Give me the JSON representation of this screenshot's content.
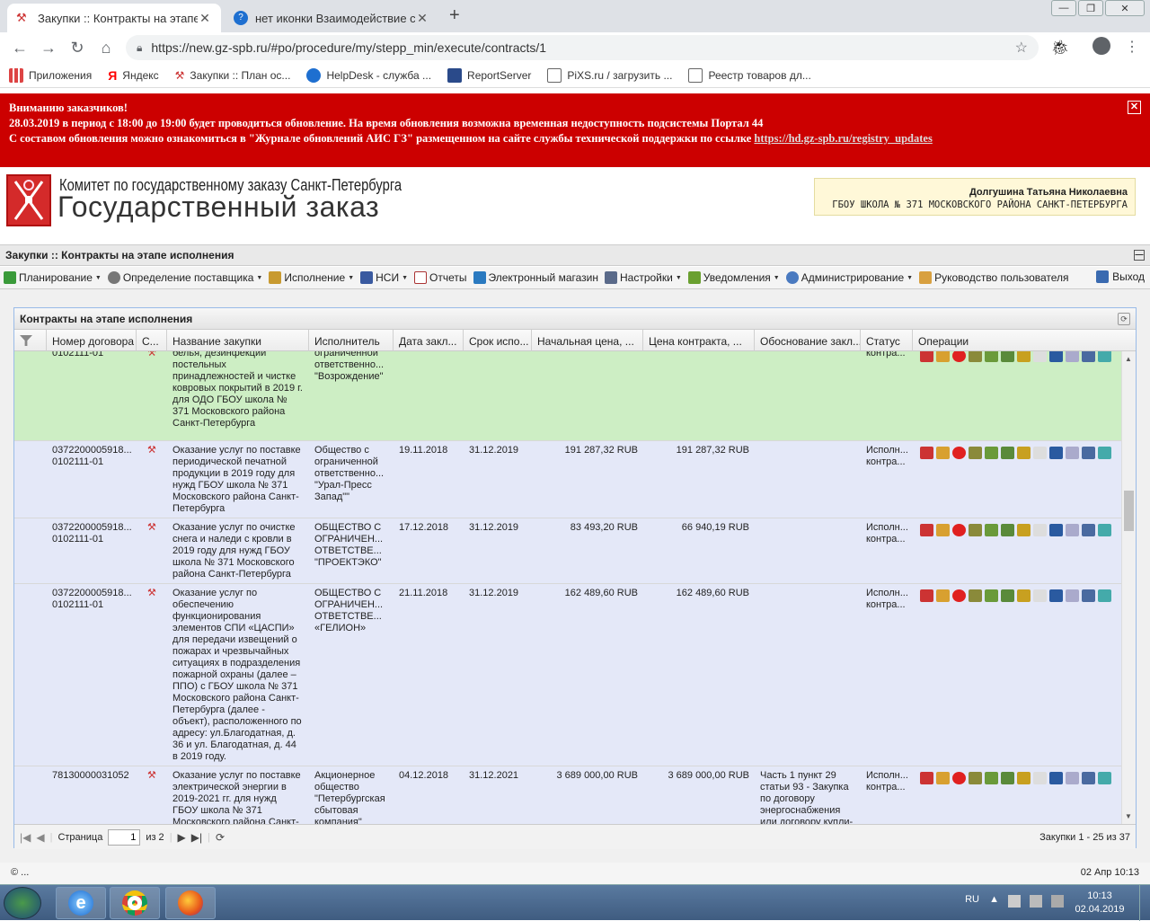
{
  "browser": {
    "tabs": [
      {
        "title": "Закупки :: Контракты на этапе и",
        "active": true
      },
      {
        "title": "нет иконки Взаимодействие с Е",
        "active": false
      }
    ],
    "new_tab": "+",
    "url": "https://new.gz-spb.ru/#po/procedure/my/stepp_min/execute/contracts/1",
    "bookmarks": [
      "Приложения",
      "Яндекс",
      "Закупки :: План ос...",
      "HelpDesk - служба ...",
      "ReportServer",
      "PiXS.ru / загрузить ...",
      "Реестр товаров дл..."
    ]
  },
  "alert": {
    "line1": "Вниманию заказчиков!",
    "line2": "28.03.2019 в период с 18:00 до 19:00 будет проводиться обновление. На время обновления возможна временная недоступность подсистемы Портал 44",
    "line3": "С составом обновления можно ознакомиться в \"Журнале обновлений АИС ГЗ\" размещенном на сайте службы технической поддержки по ссылке",
    "link": "https://hd.gz-spb.ru/registry_updates"
  },
  "header": {
    "org_line1": "Комитет по государственному заказу Санкт-Петербурга",
    "org_line2": "Государственный заказ",
    "user_name": "Долгушина Татьяна Николаевна",
    "user_org": "ГБОУ ШКОЛА № 371 МОСКОВСКОГО РАЙОНА САНКТ-ПЕТЕРБУРГА"
  },
  "panel_title": "Закупки :: Контракты на этапе исполнения",
  "menu": {
    "items": [
      "Планирование",
      "Определение поставщика",
      "Исполнение",
      "НСИ",
      "Отчеты",
      "Электронный магазин",
      "Настройки",
      "Уведомления",
      "Администрирование",
      "Руководство пользователя"
    ],
    "logout": "Выход"
  },
  "grid": {
    "title": "Контракты на этапе исполнения",
    "columns": [
      "Номер договора",
      "С...",
      "Название закупки",
      "Исполнитель",
      "Дата закл...",
      "Срок испо...",
      "Начальная цена, ...",
      "Цена контракта, ...",
      "Обоснование закл...",
      "Статус",
      "Операции"
    ],
    "rows": [
      {
        "number": "0102111-01",
        "name": "белья, дезинфекции постельных принадлежностей и чистке ковровых покрытий в 2019 г. для ОДО ГБОУ школа № 371 Московского района Санкт-Петербурга",
        "executor": "ограниченной ответственно... \"Возрождение\"",
        "date": "",
        "term": "",
        "start_price": "",
        "price": "",
        "basis": "",
        "status": "контра..."
      },
      {
        "number": "0372200005918... 0102111-01",
        "name": "Оказание услуг по поставке периодической печатной продукции в 2019 году для нужд ГБОУ школа № 371 Московского района Санкт-Петербурга",
        "executor": "Общество с ограниченной ответственно... \"Урал-Пресс Запад\"\"",
        "date": "19.11.2018",
        "term": "31.12.2019",
        "start_price": "191 287,32 RUB",
        "price": "191 287,32 RUB",
        "basis": "",
        "status": "Исполн... контра..."
      },
      {
        "number": "0372200005918... 0102111-01",
        "name": "Оказание услуг по очистке снега и наледи с кровли в 2019 году для нужд ГБОУ школа № 371 Московского района Санкт-Петербурга",
        "executor": "ОБЩЕСТВО С ОГРАНИЧЕН... ОТВЕТСТВЕ... \"ПРОЕКТЭКО\"",
        "date": "17.12.2018",
        "term": "31.12.2019",
        "start_price": "83 493,20 RUB",
        "price": "66 940,19 RUB",
        "basis": "",
        "status": "Исполн... контра..."
      },
      {
        "number": "0372200005918... 0102111-01",
        "name": "Оказание услуг по обеспечению функционирования элементов СПИ «ЦАСПИ» для передачи извещений о пожарах и чрезвычайных ситуациях в подразделения пожарной охраны (далее – ППО) с ГБОУ школа № 371 Московского района Санкт-Петербурга (далее - объект), расположенного по адресу: ул.Благодатная, д. 36 и ул. Благодатная, д. 44 в 2019 году.",
        "executor": "ОБЩЕСТВО С ОГРАНИЧЕН... ОТВЕТСТВЕ... «ГЕЛИОН»",
        "date": "21.11.2018",
        "term": "31.12.2019",
        "start_price": "162 489,60 RUB",
        "price": "162 489,60 RUB",
        "basis": "",
        "status": "Исполн... контра..."
      },
      {
        "number": "78130000031052",
        "name": "Оказание услуг по поставке электрической энергии в 2019-2021 гг. для нужд ГБОУ школа № 371 Московского района Санкт-Петербурга",
        "executor": "Акционерное общество \"Петербургская сбытовая компания\"",
        "date": "04.12.2018",
        "term": "31.12.2021",
        "start_price": "3 689 000,00 RUB",
        "price": "3 689 000,00 RUB",
        "basis": "Часть 1 пункт 29 статьи 93 - Закупка по договору энергоснабжения или договору купли-",
        "status": "Исполн... контра..."
      }
    ],
    "pager": {
      "page_label": "Страница",
      "page": "1",
      "of": "из 2",
      "info": "Закупки 1 - 25 из 37"
    }
  },
  "footer": {
    "left": "© ...",
    "right": "02 Апр 10:13"
  },
  "taskbar": {
    "lang": "RU",
    "time": "10:13",
    "date": "02.04.2019"
  }
}
